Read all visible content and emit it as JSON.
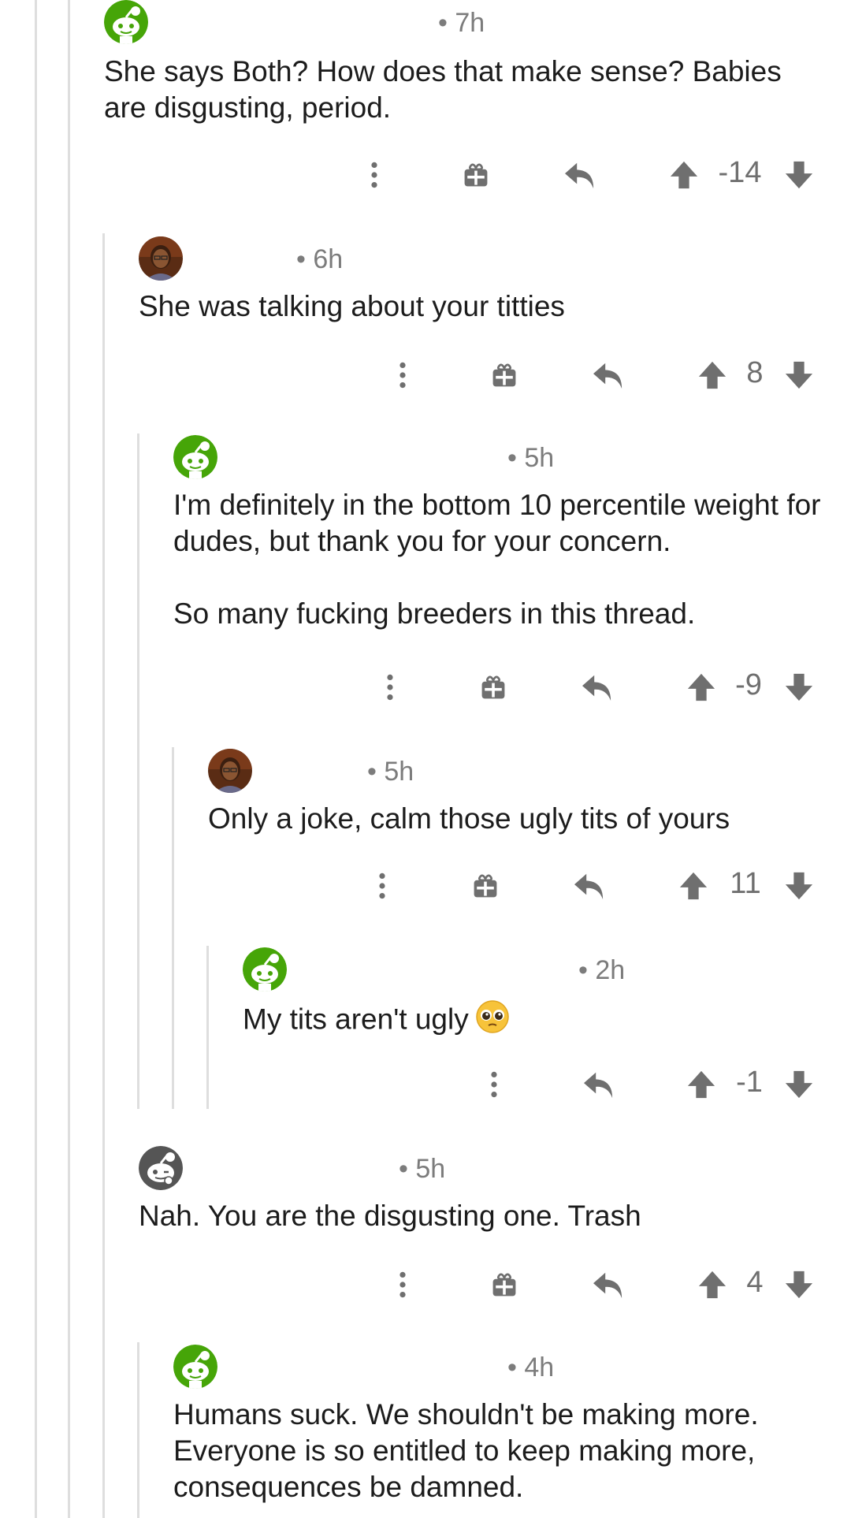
{
  "comments": [
    {
      "avatar": "snoo-green-avatar",
      "time": "• 7h",
      "body": [
        "She says Both? How does that make sense? Babies are disgusting, period."
      ],
      "score": "-14",
      "has_award": true
    },
    {
      "avatar": "profile-photo-avatar",
      "time": "• 6h",
      "body": [
        "She was talking about your titties"
      ],
      "score": "8",
      "has_award": true
    },
    {
      "avatar": "snoo-green-avatar",
      "time": "• 5h",
      "body": [
        "I'm definitely in the bottom 10 percentile weight for dudes, but thank you for your concern.",
        "So many fucking breeders in this thread."
      ],
      "score": "-9",
      "has_award": true
    },
    {
      "avatar": "profile-photo-avatar",
      "time": "• 5h",
      "body": [
        "Only a joke, calm those ugly tits of yours"
      ],
      "score": "11",
      "has_award": true
    },
    {
      "avatar": "snoo-green-avatar",
      "time": "• 2h",
      "body": [
        "My tits aren't ugly"
      ],
      "emoji": "pleading-face-emoji",
      "score": "-1",
      "has_award": false
    },
    {
      "avatar": "snoo-gray-avatar",
      "time": "• 5h",
      "body": [
        "Nah. You are the disgusting one. Trash"
      ],
      "score": "4",
      "has_award": true
    },
    {
      "avatar": "snoo-green-avatar",
      "time": "• 4h",
      "body": [
        "Humans suck. We shouldn't be making more. Everyone is so entitled to keep making more, consequences be damned."
      ],
      "score": "",
      "has_award": false
    }
  ],
  "icons": {
    "more": "more-options-icon",
    "award": "give-award-icon",
    "reply": "reply-icon",
    "upvote": "upvote-arrow-icon",
    "downvote": "downvote-arrow-icon"
  },
  "colors": {
    "snoo_green": "#46a508",
    "text": "#1c1c1c",
    "meta": "#7c7c7c",
    "icon": "#6f6f6f",
    "thread_line": "#dedede"
  }
}
